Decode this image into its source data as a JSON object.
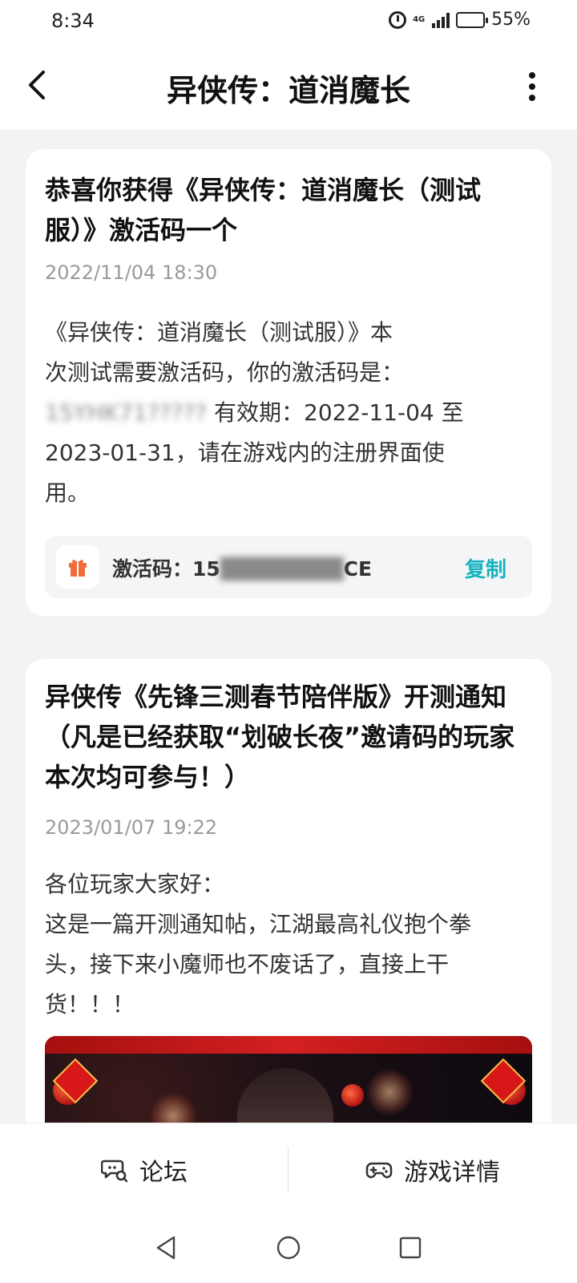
{
  "status_bar": {
    "time": "8:34",
    "network": "4G",
    "battery": "55%",
    "battery_level": 0.55
  },
  "header": {
    "title": "异侠传：道消魔长"
  },
  "posts": [
    {
      "title": "恭喜你获得《异侠传：道消魔长（测试服）》激活码一个",
      "date": "2022/11/04 18:30",
      "body_lines": [
        "《异侠传：道消魔长（测试服）》本",
        "次测试需要激活码，你的激活码是：",
        "15YHK71?????",
        "有效期：2022-11-04 至",
        "2023-01-31，请在游戏内的注册界面使",
        "用。"
      ],
      "code": {
        "label": "激活码：",
        "value_visible_start": "15",
        "value_visible_end": "CE",
        "copy_label": "复制"
      }
    },
    {
      "title": "异侠传《先锋三测春节陪伴版》开测通知（凡是已经获取“划破长夜”邀请码的玩家本次均可参与！）",
      "date": "2023/01/07 19:22",
      "body_lines": [
        "各位玩家大家好：",
        "这是一篇开测通知帖，江湖最高礼仪抱个拳",
        "头，接下来小魔师也不废话了，直接上干",
        "货！！！"
      ]
    }
  ],
  "bottom_tabs": {
    "forum": "论坛",
    "game_detail": "游戏详情"
  },
  "icons": {
    "back": "back-arrow-icon",
    "more": "more-vertical-icon",
    "gift": "gift-icon",
    "forum": "chat-search-icon",
    "game": "gamepad-icon"
  },
  "colors": {
    "accent": "#14b4bf",
    "gift": "#f26b3a",
    "date": "#9a9a9e"
  }
}
